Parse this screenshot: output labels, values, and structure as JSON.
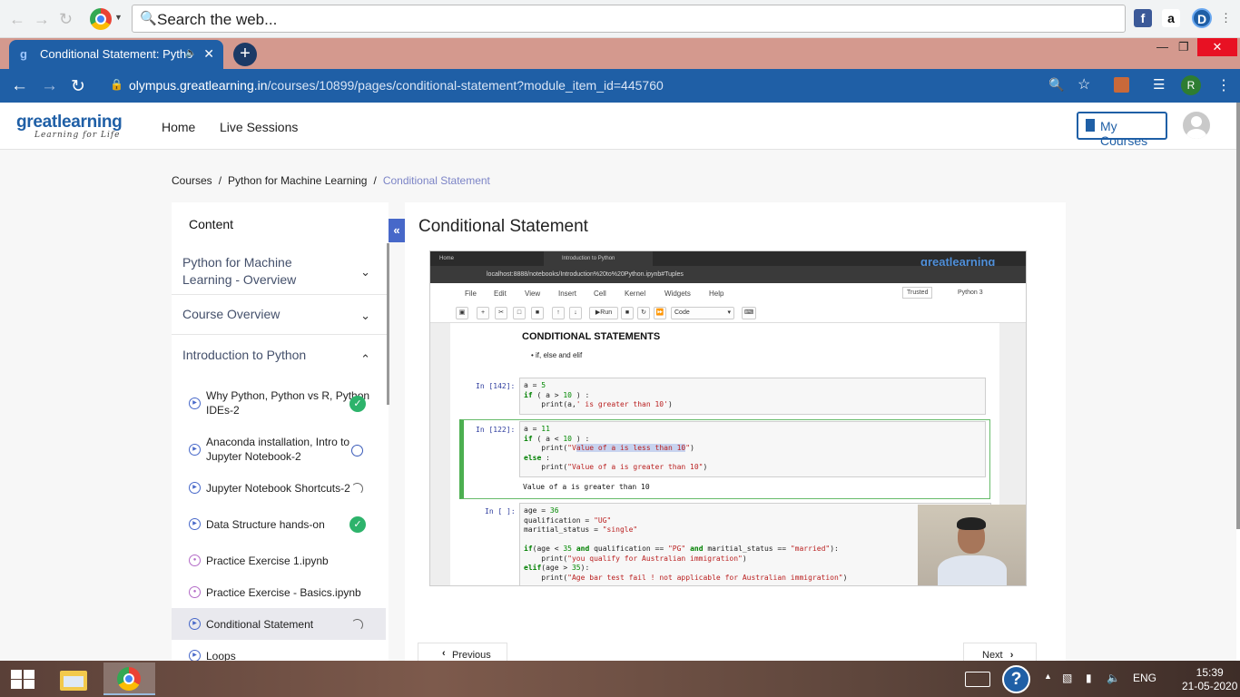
{
  "topbar": {
    "search_placeholder": "Search the web..."
  },
  "browser": {
    "tab_title": "Conditional Statement: Pytho",
    "url_host": "olympus.greatlearning.in",
    "url_path": "/courses/10899/pages/conditional-statement?module_item_id=445760",
    "profile_initial": "R"
  },
  "site": {
    "logo": "greatlearning",
    "logo_tagline": "Learning for Life",
    "nav": [
      "Home",
      "Live Sessions"
    ],
    "my_courses": "My Courses"
  },
  "breadcrumb": [
    "Courses",
    "Python for Machine Learning",
    "Conditional Statement"
  ],
  "sidebar": {
    "heading": "Content",
    "sections": [
      {
        "label": "Python for Machine Learning - Overview"
      },
      {
        "label": "Course Overview"
      },
      {
        "label": "Introduction to Python"
      }
    ],
    "items": [
      {
        "label": "Why Python, Python vs R, Python IDEs-2",
        "status": "completed"
      },
      {
        "label": "Anaconda installation, Intro to Jupyter Notebook-2",
        "status": "not-started"
      },
      {
        "label": "Jupyter Notebook Shortcuts-2",
        "status": "in-progress"
      },
      {
        "label": "Data Structure hands-on",
        "status": "completed"
      },
      {
        "label": "Practice Exercise 1.ipynb",
        "status": ""
      },
      {
        "label": "Practice Exercise - Basics.ipynb",
        "status": ""
      },
      {
        "label": "Conditional Statement",
        "status": "in-progress"
      },
      {
        "label": "Loops",
        "status": ""
      }
    ]
  },
  "lesson": {
    "title": "Conditional Statement",
    "prev": "Previous",
    "next": "Next"
  },
  "video": {
    "tab1": "Home",
    "tab2": "Introduction to Python",
    "address": "localhost:8888/notebooks/Introduction%20to%20Python.ipynb#Tuples",
    "brand": "greatlearning",
    "menu": [
      "File",
      "Edit",
      "View",
      "Insert",
      "Cell",
      "Kernel",
      "Widgets",
      "Help"
    ],
    "trusted": "Trusted",
    "kernel": "Python 3",
    "run": "Run",
    "cell_type": "Code",
    "heading": "CONDITIONAL STATEMENTS",
    "bullet": "if, else and elif",
    "prompt1": "In [142]:",
    "prompt2": "In [122]:",
    "prompt3": "In [ ]:",
    "output2": "Value of a is greater than 10"
  },
  "taskbar": {
    "lang": "ENG",
    "time": "15:39",
    "date": "21-05-2020"
  },
  "colors": {
    "brand_blue": "#1f5fa6",
    "tab_strip": "#d4998e",
    "accent_purple": "#7c84c6",
    "done_green": "#2db36b"
  }
}
